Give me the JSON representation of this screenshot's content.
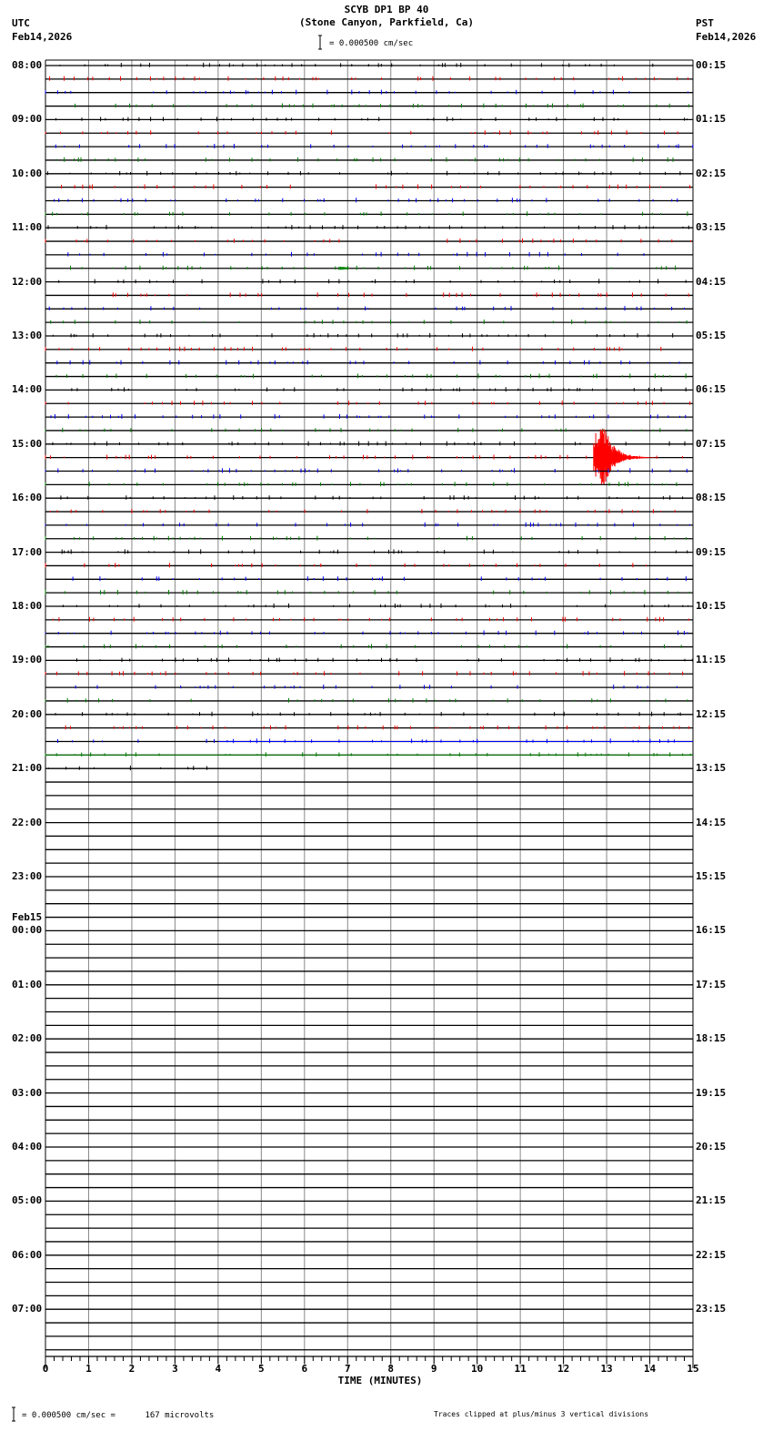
{
  "header": {
    "title": "SCYB DP1 BP 40",
    "subtitle": "(Stone Canyon, Parkfield, Ca)",
    "left_tz": "UTC",
    "left_date": "Feb14,2026",
    "right_tz": "PST",
    "right_date": "Feb14,2026",
    "scale_text": "= 0.000500 cm/sec"
  },
  "footer": {
    "scale_text": "= 0.000500 cm/sec =      167 microvolts",
    "clip_note": "Traces clipped at plus/minus 3 vertical divisions"
  },
  "chart_data": {
    "type": "line",
    "title": "SCYB DP1 BP 40",
    "xlabel": "TIME (MINUTES)",
    "xlim": [
      0,
      15
    ],
    "x_ticks": [
      "0",
      "1",
      "2",
      "3",
      "4",
      "5",
      "6",
      "7",
      "8",
      "9",
      "10",
      "11",
      "12",
      "13",
      "14",
      "15"
    ],
    "rows_per_hour": 4,
    "row_colors": [
      "#000000",
      "#ff0000",
      "#0000ff",
      "#008000"
    ],
    "left_labels": [
      "08:00",
      "09:00",
      "10:00",
      "11:00",
      "12:00",
      "13:00",
      "14:00",
      "15:00",
      "16:00",
      "17:00",
      "18:00",
      "19:00",
      "20:00",
      "21:00",
      "22:00",
      "23:00",
      "00:00",
      "01:00",
      "02:00",
      "03:00",
      "04:00",
      "05:00",
      "06:00",
      "07:00"
    ],
    "date_change_label": "Feb15",
    "right_labels": [
      "00:15",
      "01:15",
      "02:15",
      "03:15",
      "04:15",
      "05:15",
      "06:15",
      "07:15",
      "08:15",
      "09:15",
      "10:15",
      "11:15",
      "12:15",
      "13:15",
      "14:15",
      "15:15",
      "16:15",
      "17:15",
      "18:15",
      "19:15",
      "20:15",
      "21:15",
      "22:15",
      "23:15"
    ],
    "data_end": {
      "row_utc": "21:00",
      "minute": 4
    },
    "events": [
      {
        "row_utc": "15:15",
        "start_minute": 12.7,
        "peak_minute": 12.9,
        "end_minute": 14.2,
        "amplitude_divisions": 3,
        "clipped": true
      },
      {
        "row_utc": "11:45",
        "start_minute": 6.8,
        "end_minute": 7.0,
        "amplitude_divisions": 0.2
      }
    ]
  }
}
